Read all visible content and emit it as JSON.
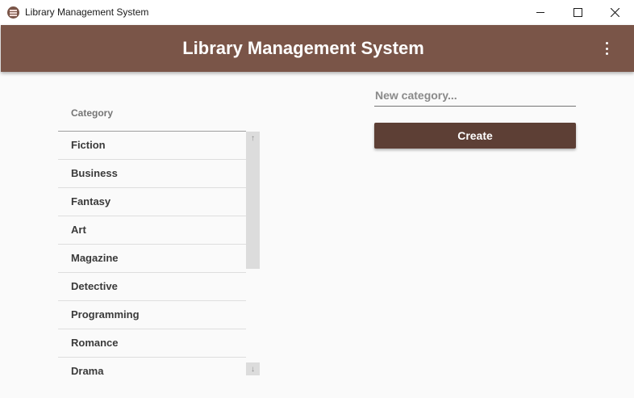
{
  "window": {
    "title": "Library Management System",
    "controls": {
      "minimize": "minimize-icon",
      "maximize": "maximize-icon",
      "close": "close-icon"
    }
  },
  "appbar": {
    "title": "Library Management System",
    "menu_icon": "more-vert-icon",
    "color": "#7a5548"
  },
  "category_list": {
    "header": "Category",
    "items": [
      "Fiction",
      "Business",
      "Fantasy",
      "Art",
      "Magazine",
      "Detective",
      "Programming",
      "Romance",
      "Drama"
    ]
  },
  "form": {
    "input_placeholder": "New category...",
    "input_value": "",
    "create_label": "Create",
    "button_color": "#5d3f35"
  }
}
